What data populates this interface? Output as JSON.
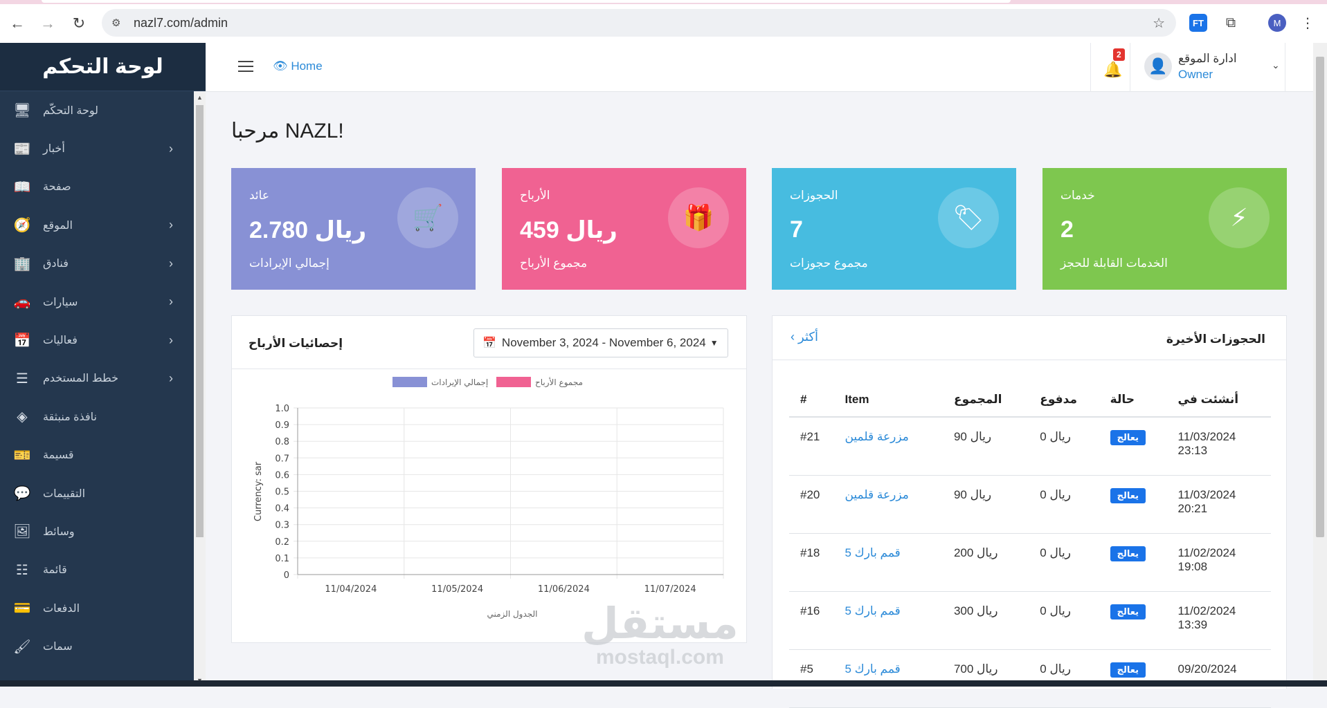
{
  "browser": {
    "url": "nazl7.com/admin",
    "profile_initial": "M",
    "ext_label": "FT"
  },
  "sidebar": {
    "brand": "لوحة التحكم",
    "items": [
      {
        "label": "لوحة التحكّم",
        "icon": "monitor-icon",
        "glyph": "🖥",
        "has_children": false
      },
      {
        "label": "أخبار",
        "icon": "newspaper-icon",
        "glyph": "📰",
        "has_children": true
      },
      {
        "label": "صفحة",
        "icon": "book-icon",
        "glyph": "📖",
        "has_children": false
      },
      {
        "label": "الموقع",
        "icon": "compass-icon",
        "glyph": "🧭",
        "has_children": true
      },
      {
        "label": "فنادق",
        "icon": "building-icon",
        "glyph": "🏢",
        "has_children": true
      },
      {
        "label": "سيارات",
        "icon": "car-icon",
        "glyph": "🚗",
        "has_children": true
      },
      {
        "label": "فعاليات",
        "icon": "calendar-icon",
        "glyph": "📅",
        "has_children": true
      },
      {
        "label": "خطط المستخدم",
        "icon": "list-icon",
        "glyph": "☰",
        "has_children": true
      },
      {
        "label": "نافذة منبثقة",
        "icon": "cube-icon",
        "glyph": "◈",
        "has_children": false
      },
      {
        "label": "قسيمة",
        "icon": "ticket-icon",
        "glyph": "🎫",
        "has_children": false
      },
      {
        "label": "التقييمات",
        "icon": "comment-icon",
        "glyph": "💬",
        "has_children": false
      },
      {
        "label": "وسائط",
        "icon": "image-icon",
        "glyph": "🖼",
        "has_children": false
      },
      {
        "label": "قائمة",
        "icon": "layers-icon",
        "glyph": "☷",
        "has_children": false
      },
      {
        "label": "الدفعات",
        "icon": "credit-card-icon",
        "glyph": "💳",
        "has_children": false
      },
      {
        "label": "سمات",
        "icon": "brush-icon",
        "glyph": "🖌",
        "has_children": false
      }
    ]
  },
  "topbar": {
    "home_label": "Home",
    "notification_count": "2",
    "user_name": "ادارة الموقع",
    "user_role": "Owner"
  },
  "welcome": "مرحبا NAZL!",
  "cards": [
    {
      "title": "عائد",
      "value": "2.780 ريال",
      "desc": "إجمالي الإيرادات",
      "color": "#8891d5",
      "icon": "cart-icon",
      "glyph": "🛒"
    },
    {
      "title": "الأرباح",
      "value": "459 ريال",
      "desc": "مجموع الأرباح",
      "color": "#f06292",
      "icon": "gift-icon",
      "glyph": "🎁"
    },
    {
      "title": "الحجوزات",
      "value": "7",
      "desc": "مجموع حجوزات",
      "color": "#47bce0",
      "icon": "tag-icon",
      "glyph": "🏷"
    },
    {
      "title": "خدمات",
      "value": "2",
      "desc": "الخدمات القابلة للحجز",
      "color": "#7ec74f",
      "icon": "bolt-icon",
      "glyph": "⚡"
    }
  ],
  "earnings_panel": {
    "title": "إحصائيات الأرباح",
    "date_range": "November 3, 2024 - November 6, 2024"
  },
  "chart_data": {
    "type": "line",
    "title": "",
    "xlabel": "الجدول الزمني",
    "ylabel": "Currency: sar",
    "categories": [
      "11/04/2024",
      "11/05/2024",
      "11/06/2024",
      "11/07/2024"
    ],
    "ylim": [
      0,
      1.0
    ],
    "yticks": [
      "0",
      "0.1",
      "0.2",
      "0.3",
      "0.4",
      "0.5",
      "0.6",
      "0.7",
      "0.8",
      "0.9",
      "1.0"
    ],
    "legend_position": "top",
    "series": [
      {
        "name": "مجموع الأرباح",
        "color": "#f06292",
        "values": []
      },
      {
        "name": "إجمالي الإيرادات",
        "color": "#8891d5",
        "values": []
      }
    ]
  },
  "bookings_panel": {
    "title": "الحجوزات الأخيرة",
    "more_label": "أكثر",
    "columns": [
      "#",
      "Item",
      "المجموع",
      "مدفوع",
      "حالة",
      "أنشئت في"
    ],
    "rows": [
      {
        "id": "#21",
        "item": "مزرعة قلمين",
        "total": "90 ريال",
        "paid": "0 ريال",
        "status": "يعالج",
        "date": "11/03/2024",
        "time": "23:13"
      },
      {
        "id": "#20",
        "item": "مزرعة قلمين",
        "total": "90 ريال",
        "paid": "0 ريال",
        "status": "يعالج",
        "date": "11/03/2024",
        "time": "20:21"
      },
      {
        "id": "#18",
        "item": "قمم بارك 5",
        "total": "200 ريال",
        "paid": "0 ريال",
        "status": "يعالج",
        "date": "11/02/2024",
        "time": "19:08"
      },
      {
        "id": "#16",
        "item": "قمم بارك 5",
        "total": "300 ريال",
        "paid": "0 ريال",
        "status": "يعالج",
        "date": "11/02/2024",
        "time": "13:39"
      },
      {
        "id": "#5",
        "item": "قمم بارك 5",
        "total": "700 ريال",
        "paid": "0 ريال",
        "status": "يعالج",
        "date": "09/20/2024",
        "time": ""
      }
    ]
  },
  "watermark": {
    "arabic": "مستقل",
    "latin": "mostaql.com"
  }
}
